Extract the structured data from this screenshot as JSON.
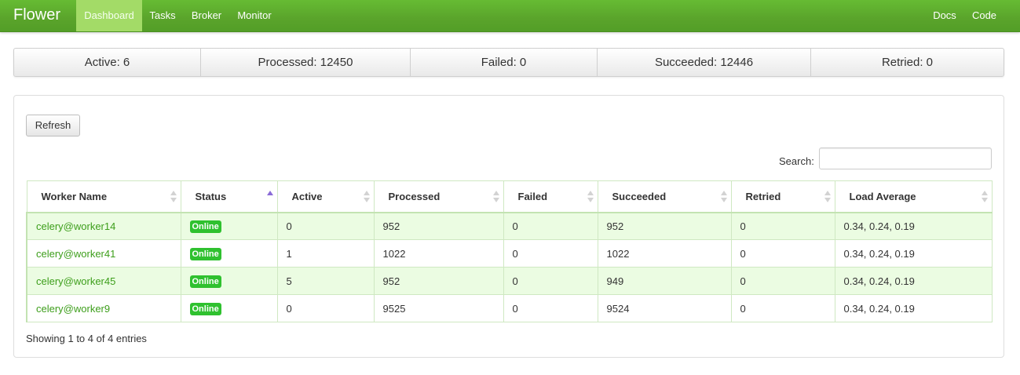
{
  "navbar": {
    "brand": "Flower",
    "items": [
      {
        "label": "Dashboard",
        "active": true
      },
      {
        "label": "Tasks",
        "active": false
      },
      {
        "label": "Broker",
        "active": false
      },
      {
        "label": "Monitor",
        "active": false
      }
    ],
    "right_items": [
      {
        "label": "Docs"
      },
      {
        "label": "Code"
      }
    ]
  },
  "stats": [
    {
      "label": "Active: 6"
    },
    {
      "label": "Processed: 12450"
    },
    {
      "label": "Failed: 0"
    },
    {
      "label": "Succeeded: 12446"
    },
    {
      "label": "Retried: 0"
    }
  ],
  "panel": {
    "refresh_label": "Refresh",
    "search_label": "Search:",
    "search_value": "",
    "info": "Showing 1 to 4 of 4 entries"
  },
  "table": {
    "columns": [
      {
        "label": "Worker Name",
        "sort": "none"
      },
      {
        "label": "Status",
        "sort": "asc"
      },
      {
        "label": "Active",
        "sort": "none"
      },
      {
        "label": "Processed",
        "sort": "none"
      },
      {
        "label": "Failed",
        "sort": "none"
      },
      {
        "label": "Succeeded",
        "sort": "none"
      },
      {
        "label": "Retried",
        "sort": "none"
      },
      {
        "label": "Load Average",
        "sort": "none"
      }
    ],
    "rows": [
      {
        "name": "celery@worker14",
        "status": "Online",
        "active": "0",
        "processed": "952",
        "failed": "0",
        "succeeded": "952",
        "retried": "0",
        "load": "0.34, 0.24, 0.19"
      },
      {
        "name": "celery@worker41",
        "status": "Online",
        "active": "1",
        "processed": "1022",
        "failed": "0",
        "succeeded": "1022",
        "retried": "0",
        "load": "0.34, 0.24, 0.19"
      },
      {
        "name": "celery@worker45",
        "status": "Online",
        "active": "5",
        "processed": "952",
        "failed": "0",
        "succeeded": "949",
        "retried": "0",
        "load": "0.34, 0.24, 0.19"
      },
      {
        "name": "celery@worker9",
        "status": "Online",
        "active": "0",
        "processed": "9525",
        "failed": "0",
        "succeeded": "9524",
        "retried": "0",
        "load": "0.34, 0.24, 0.19"
      }
    ]
  },
  "colors": {
    "navbar": "#5aa42b",
    "nav_active": "#a3db67",
    "link": "#3d9e1b",
    "online_badge": "#2fc12f",
    "row_highlight": "#ebfce2",
    "sort_active": "#8a6bd7"
  },
  "icons": {
    "sort": "sort-both-icon",
    "sort_asc": "sort-ascending-icon"
  }
}
